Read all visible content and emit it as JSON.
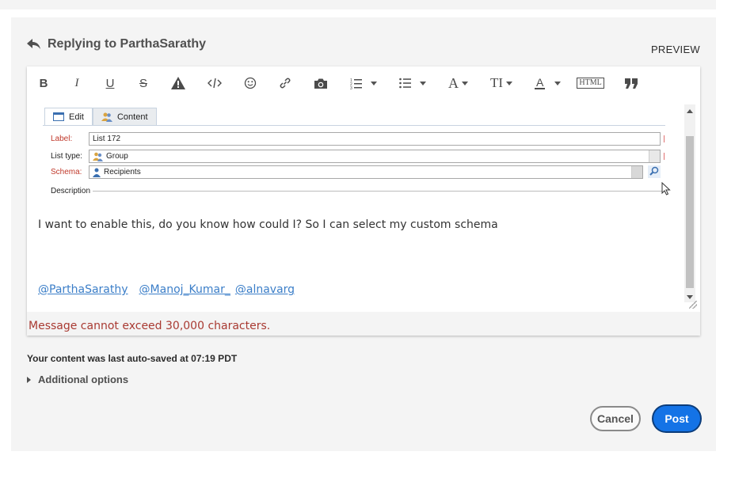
{
  "reply": {
    "heading": "Replying to ParthaSarathy",
    "preview_label": "PREVIEW"
  },
  "toolbar": {
    "items": [
      "bold",
      "italic",
      "underline",
      "strikethrough",
      "warning",
      "code",
      "emoji",
      "link",
      "camera",
      "ordered-list",
      "bulleted-list",
      "font",
      "font-size",
      "font-color",
      "html",
      "quote"
    ],
    "bold_glyph": "B",
    "italic_glyph": "I",
    "underline_glyph": "U",
    "strike_glyph": "S",
    "font_glyph": "A",
    "fontsize_glyph": "TI",
    "color_glyph": "A",
    "html_glyph": "HTML"
  },
  "embedded_screenshot": {
    "tabs": [
      "Edit",
      "Content"
    ],
    "fields": [
      {
        "label": "Label:",
        "value": "List 172",
        "required": true
      },
      {
        "label": "List type:",
        "value": "Group",
        "required": false
      },
      {
        "label": "Schema:",
        "value": "Recipients",
        "required": true
      }
    ],
    "description_label": "Description"
  },
  "message": {
    "body": "I want to enable this, do you know how could I? So I can select my custom schema",
    "mentions": [
      "@ParthaSarathy",
      "@Manoj_Kumar_",
      "@alnavarg"
    ]
  },
  "error": "Message cannot exceed 30,000 characters.",
  "autosave": "Your content was last auto-saved at 07:19 PDT",
  "additional_options": "Additional options",
  "buttons": {
    "cancel": "Cancel",
    "post": "Post"
  },
  "colors": {
    "accent": "#1473e6",
    "error": "#a93a32",
    "link": "#3b7ec8",
    "panel_bg": "#f4f4f4"
  }
}
